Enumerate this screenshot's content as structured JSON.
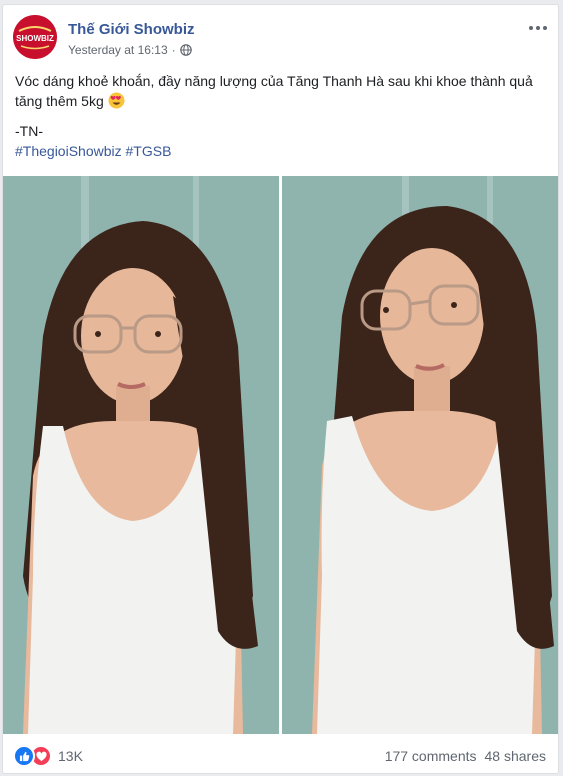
{
  "post": {
    "page_name": "Thế Giới Showbiz",
    "avatar_text": "SHOWBIZ",
    "timestamp": "Yesterday at 16:13",
    "meta_separator": "·",
    "audience_icon": "globe-icon",
    "more_icon": "more-horizontal-icon",
    "text_line": "Vóc dáng khoẻ khoắn, đầy năng lượng của Tăng Thanh Hà sau khi khoe thành quả tăng thêm 5kg",
    "emoji": "heart-eyes-emoji",
    "signature": "-TN-",
    "hashtags": [
      "#ThegioiShowbiz",
      "#TGSB"
    ]
  },
  "photos": [
    {
      "alt": "photo-1"
    },
    {
      "alt": "photo-2"
    }
  ],
  "footer": {
    "reaction_icons": [
      "like-icon",
      "love-icon"
    ],
    "reaction_count": "13K",
    "comments": "177 comments",
    "shares": "48 shares"
  },
  "colors": {
    "link": "#385898",
    "like": "#1877f2",
    "love": "#f33e58",
    "background": "#e9ebee",
    "avatar": "#c8102e",
    "photo_wall": "#8fb3ad"
  }
}
